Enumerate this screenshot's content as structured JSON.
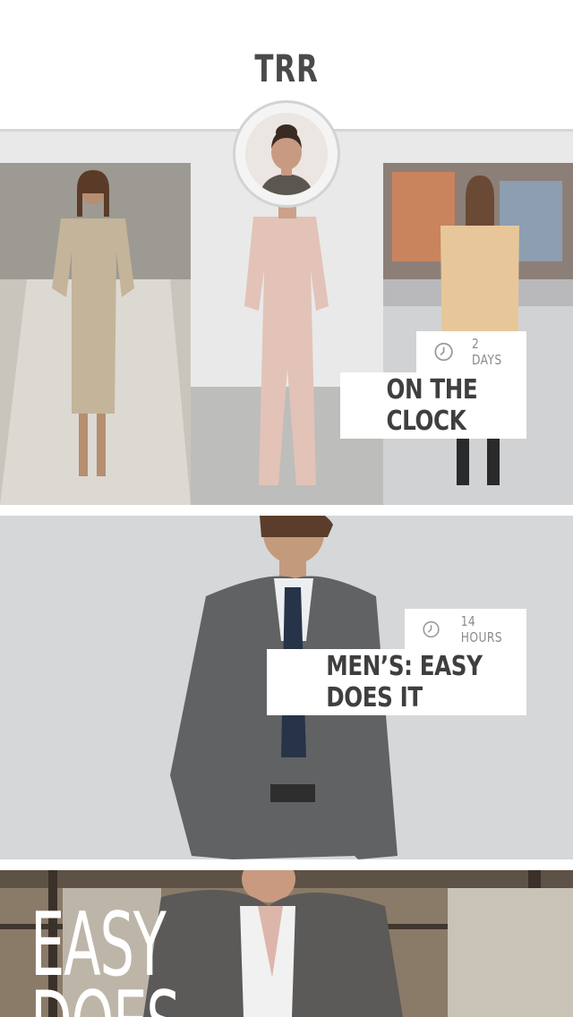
{
  "header": {
    "brand": "TRR",
    "avatar_alt": "user avatar"
  },
  "feed": {
    "items": [
      {
        "time": "2 DAYS",
        "title": "ON THE CLOCK",
        "icon": "clock-icon"
      },
      {
        "time": "14 HOURS",
        "title": "MEN’S: EASY DOES IT",
        "icon": "clock-icon"
      },
      {
        "headline_line1": "EASY",
        "headline_line2": "DOES"
      }
    ]
  }
}
